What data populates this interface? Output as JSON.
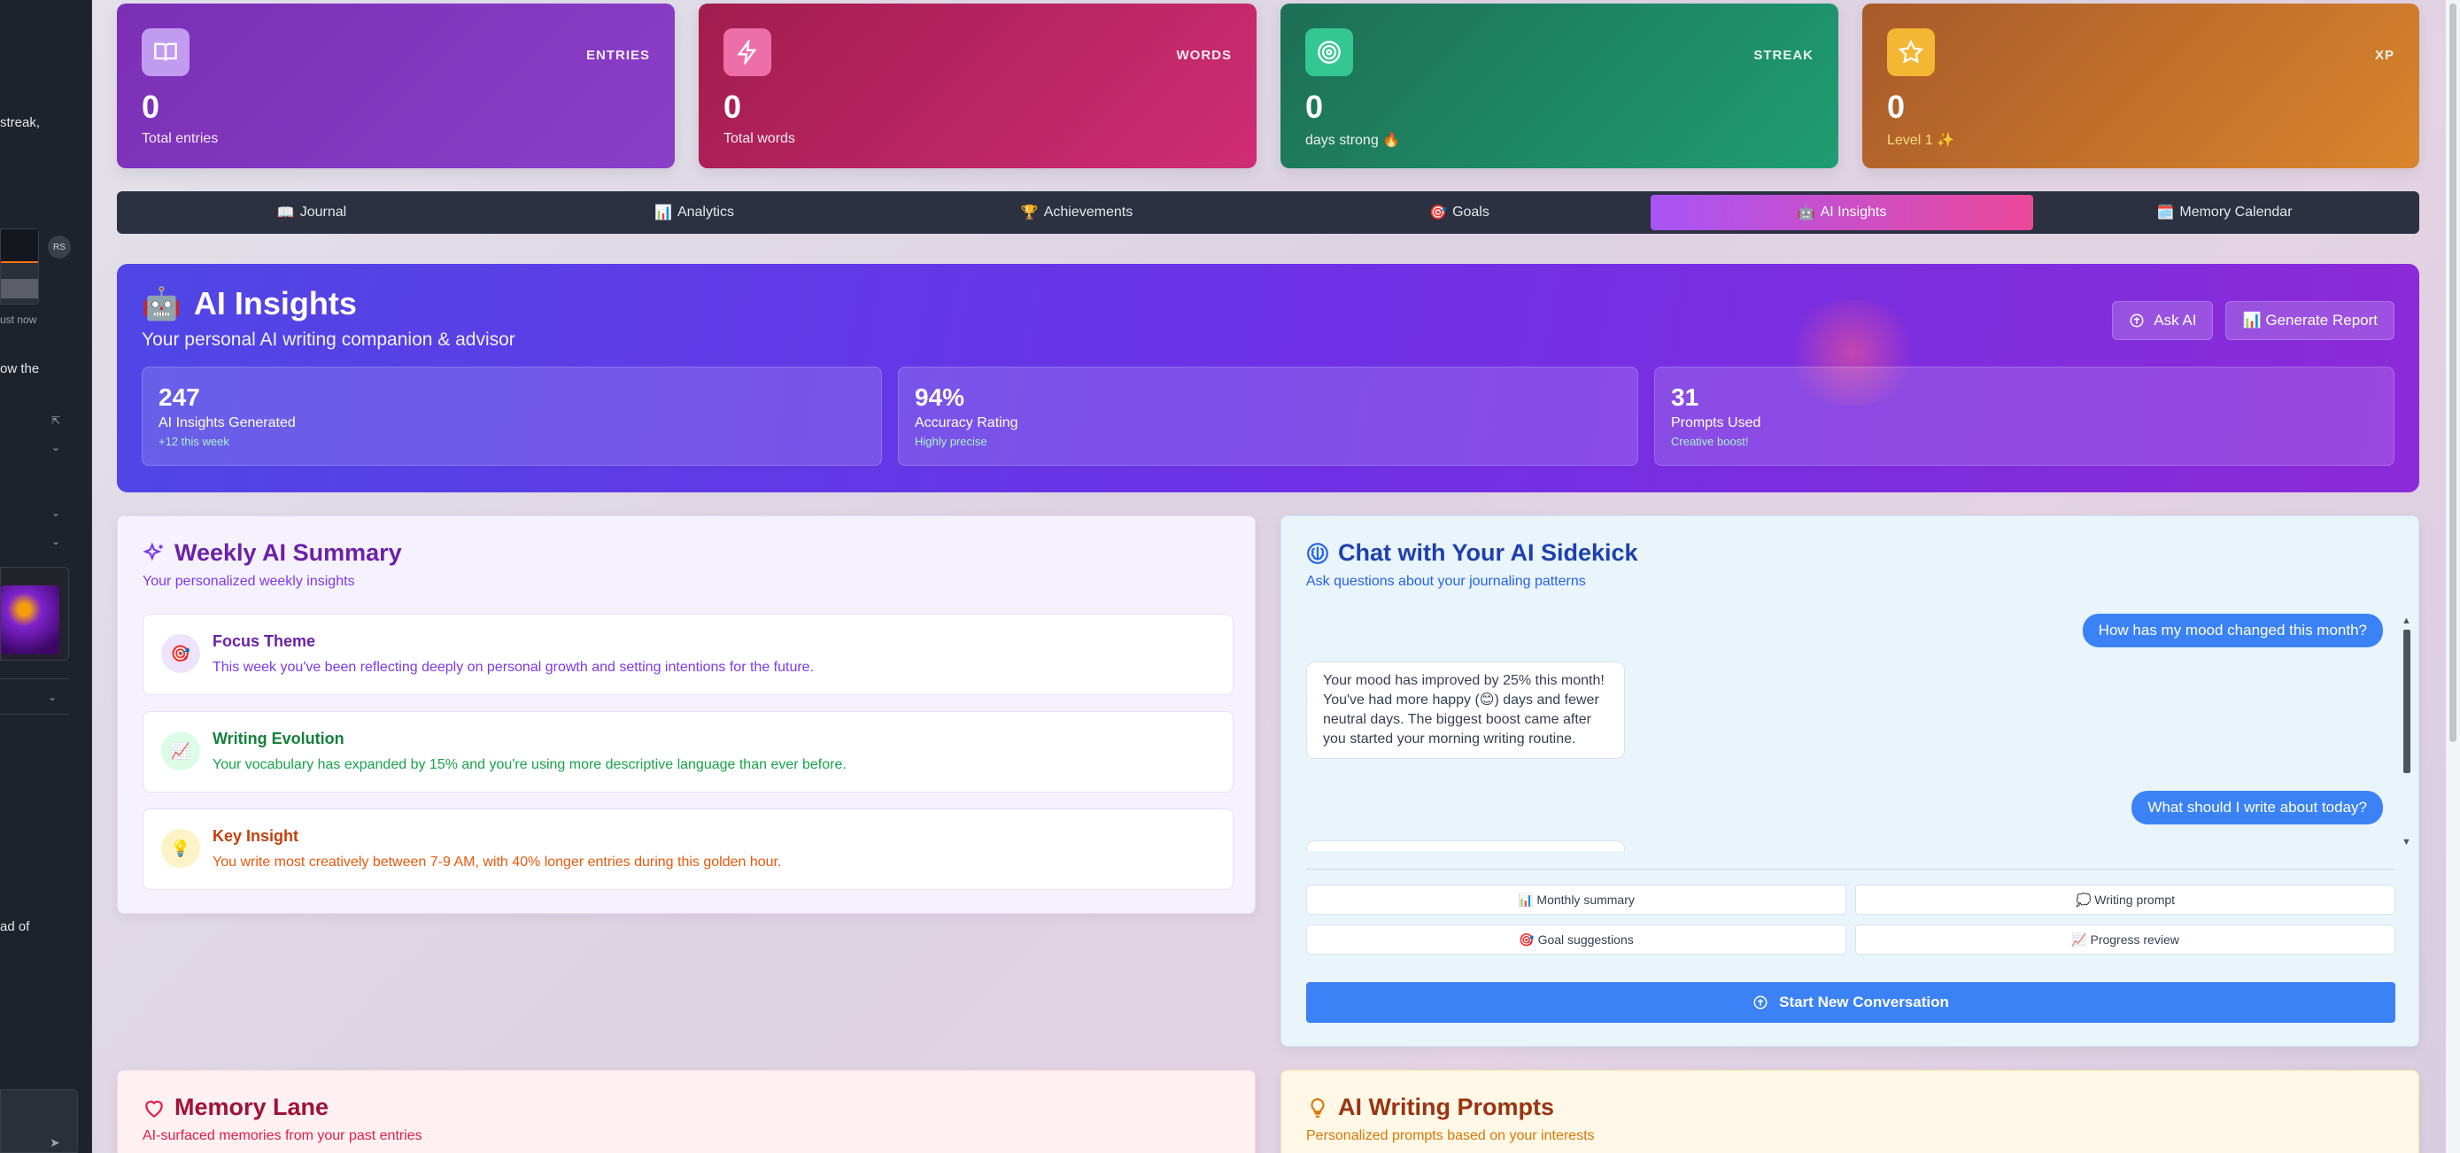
{
  "sidebar": {
    "snippets": [
      "streak,",
      "ust now",
      "ow the",
      "ad of"
    ],
    "avatar_initials": "RS"
  },
  "stats": [
    {
      "label": "ENTRIES",
      "value": "0",
      "sub": "Total entries",
      "icon": "book-icon"
    },
    {
      "label": "WORDS",
      "value": "0",
      "sub": "Total words",
      "icon": "lightning-icon"
    },
    {
      "label": "STREAK",
      "value": "0",
      "sub": "days strong 🔥",
      "icon": "target-icon"
    },
    {
      "label": "XP",
      "value": "0",
      "sub": "Level 1 ✨",
      "icon": "star-icon"
    }
  ],
  "tabs": [
    {
      "icon": "📖",
      "label": "Journal"
    },
    {
      "icon": "📊",
      "label": "Analytics"
    },
    {
      "icon": "🏆",
      "label": "Achievements"
    },
    {
      "icon": "🎯",
      "label": "Goals"
    },
    {
      "icon": "🤖",
      "label": "AI Insights"
    },
    {
      "icon": "🗓️",
      "label": "Memory Calendar"
    }
  ],
  "active_tab": "AI Insights",
  "banner": {
    "icon": "🤖",
    "title": "AI Insights",
    "tagline": "Your personal AI writing companion & advisor",
    "ask_ai": "Ask AI",
    "generate_report": "📊 Generate Report",
    "metrics": [
      {
        "value": "247",
        "label": "AI Insights Generated",
        "hint": "+12 this week"
      },
      {
        "value": "94%",
        "label": "Accuracy Rating",
        "hint": "Highly precise"
      },
      {
        "value": "31",
        "label": "Prompts Used",
        "hint": "Creative boost!"
      }
    ]
  },
  "weekly": {
    "title": "Weekly AI Summary",
    "desc": "Your personalized weekly insights",
    "cards": [
      {
        "icon": "🎯",
        "title": "Focus Theme",
        "text": "This week you've been reflecting deeply on personal growth and setting intentions for the future.",
        "color": "#6b21a8",
        "text_color": "#7c3aed",
        "icon_bg": "#ede4fb"
      },
      {
        "icon": "📈",
        "title": "Writing Evolution",
        "text": "Your vocabulary has expanded by 15% and you're using more descriptive language than ever before.",
        "color": "#15803d",
        "text_color": "#16a34a",
        "icon_bg": "#dcfce7"
      },
      {
        "icon": "💡",
        "title": "Key Insight",
        "text": "You write most creatively between 7-9 AM, with 40% longer entries during this golden hour.",
        "color": "#c2410c",
        "text_color": "#ea580c",
        "icon_bg": "#fef3c7"
      }
    ]
  },
  "chat": {
    "title": "Chat with Your AI Sidekick",
    "desc": "Ask questions about your journaling patterns",
    "messages": [
      {
        "role": "user",
        "text": "How has my mood changed this month?"
      },
      {
        "role": "ai",
        "text": "Your mood has improved by 25% this month! You've had more happy (😊) days and fewer neutral days. The biggest boost came after you started your morning writing routine."
      },
      {
        "role": "user",
        "text": "What should I write about today?"
      }
    ],
    "quick_actions": [
      "📊 Monthly summary",
      "💭 Writing prompt",
      "🎯 Goal suggestions",
      "📈 Progress review"
    ],
    "start_button": "Start New Conversation"
  },
  "memory": {
    "title": "Memory Lane",
    "desc": "AI-surfaced memories from your past entries"
  },
  "prompts": {
    "title": "AI Writing Prompts",
    "desc": "Personalized prompts based on your interests"
  },
  "colors": {
    "accent_purple": "#a855f7",
    "accent_pink": "#ec4899",
    "chat_blue": "#3b82f6"
  }
}
